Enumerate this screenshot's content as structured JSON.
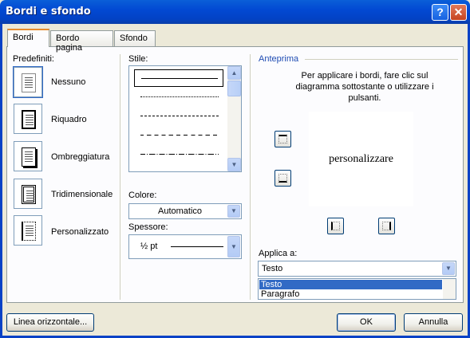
{
  "window": {
    "title": "Bordi e sfondo",
    "help_glyph": "?",
    "close_glyph": "✕"
  },
  "tabs": [
    {
      "label": "Bordi",
      "active": true
    },
    {
      "label": "Bordo pagina",
      "active": false
    },
    {
      "label": "Sfondo",
      "active": false
    }
  ],
  "presets": {
    "label": "Predefiniti:",
    "items": [
      {
        "label": "Nessuno",
        "icon": "page-none-icon",
        "selected": true
      },
      {
        "label": "Riquadro",
        "icon": "page-box-icon",
        "selected": false
      },
      {
        "label": "Ombreggiatura",
        "icon": "page-shadow-icon",
        "selected": false
      },
      {
        "label": "Tridimensionale",
        "icon": "page-3d-icon",
        "selected": false
      },
      {
        "label": "Personalizzato",
        "icon": "page-custom-icon",
        "selected": false
      }
    ]
  },
  "style": {
    "label": "Stile:",
    "options": [
      "solid",
      "dotted",
      "dashed-small",
      "dashed",
      "dash-dot"
    ]
  },
  "color": {
    "label": "Colore:",
    "value": "Automatico"
  },
  "width": {
    "label": "Spessore:",
    "value": "½ pt"
  },
  "preview": {
    "label": "Anteprima",
    "instructions": "Per applicare i bordi, fare clic sul diagramma sottostante o utilizzare i pulsanti.",
    "sample_text": "personalizzare"
  },
  "apply_to": {
    "label": "Applica a:",
    "value": "Testo",
    "options": [
      {
        "label": "Testo",
        "selected": true
      },
      {
        "label": "Paragrafo",
        "selected": false
      }
    ]
  },
  "buttons": {
    "horizontal_line": "Linea orizzontale...",
    "ok": "OK",
    "cancel": "Annulla"
  },
  "colors": {
    "titlebar": "#0249d3",
    "dialog_bg": "#ece9d8",
    "selection": "#316ac5",
    "frame": "#0842c6"
  }
}
